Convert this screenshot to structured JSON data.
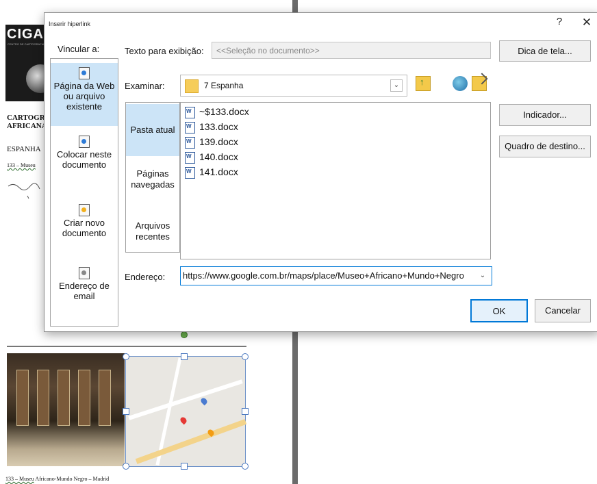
{
  "document": {
    "logo_text": "CIGA",
    "logo_subtext": "CENTRO DE CARTOGRAFIA",
    "heading": "CARTOGRAFIA\nAFRICANA",
    "section": "ESPANHA",
    "item_label": "133 – Museu",
    "caption_prefix": "133 – Museu",
    "caption_rest": " Africano-Mundo Negro – Madrid"
  },
  "dialog": {
    "title": "Inserir hiperlink",
    "help": "?",
    "close": "✕",
    "vincular_label": "Vincular a:",
    "link_options": [
      {
        "label": "Página da Web ou arquivo existente",
        "selected": true
      },
      {
        "label": "Colocar neste documento",
        "selected": false
      },
      {
        "label": "Criar novo documento",
        "selected": false
      },
      {
        "label": "Endereço de email",
        "selected": false
      }
    ],
    "texto_label": "Texto para exibição:",
    "texto_value": "<<Seleção no documento>>",
    "dica_button": "Dica de tela...",
    "examinar_label": "Examinar:",
    "examinar_value": "7 Espanha",
    "nav_items": [
      {
        "label": "Pasta atual",
        "selected": true
      },
      {
        "label": "Páginas navegadas",
        "selected": false
      },
      {
        "label": "Arquivos recentes",
        "selected": false
      }
    ],
    "files": [
      "~$133.docx",
      "133.docx",
      "139.docx",
      "140.docx",
      "141.docx"
    ],
    "indicador_button": "Indicador...",
    "quadro_button": "Quadro de destino...",
    "endereco_label": "Endereço:",
    "endereco_value": "https://www.google.com.br/maps/place/Museo+Africano+Mundo+Negro",
    "ok_button": "OK",
    "cancelar_button": "Cancelar"
  },
  "colors": {
    "selection": "#cce4f7",
    "accent": "#0078d7"
  }
}
